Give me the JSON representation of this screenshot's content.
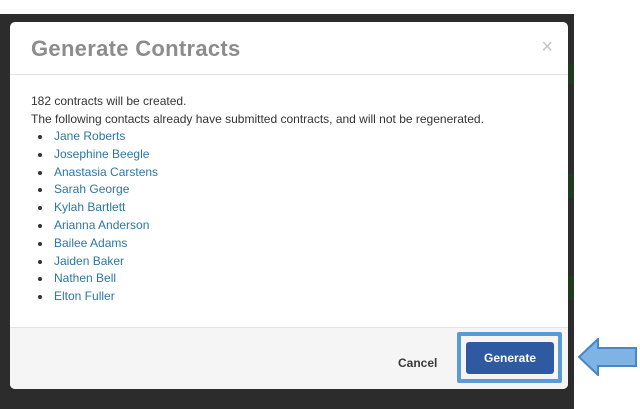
{
  "modal": {
    "title": "Generate Contracts",
    "close_icon": "×",
    "summary": "182 contracts will be created.",
    "note": "The following contacts already have submitted contracts, and will not be regenerated.",
    "contacts": [
      "Jane Roberts",
      "Josephine Beegle",
      "Anastasia Carstens",
      "Sarah George",
      "Kylah Bartlett",
      "Arianna Anderson",
      "Bailee Adams",
      "Jaiden Baker",
      "Nathen Bell",
      "Elton Fuller"
    ],
    "cancel_label": "Cancel",
    "generate_label": "Generate"
  },
  "colors": {
    "primary_button": "#2f5aa2",
    "highlight": "#5b9bd5",
    "link": "#2b76a5"
  },
  "icons": [
    "close-icon",
    "pointer-arrow-icon"
  ]
}
